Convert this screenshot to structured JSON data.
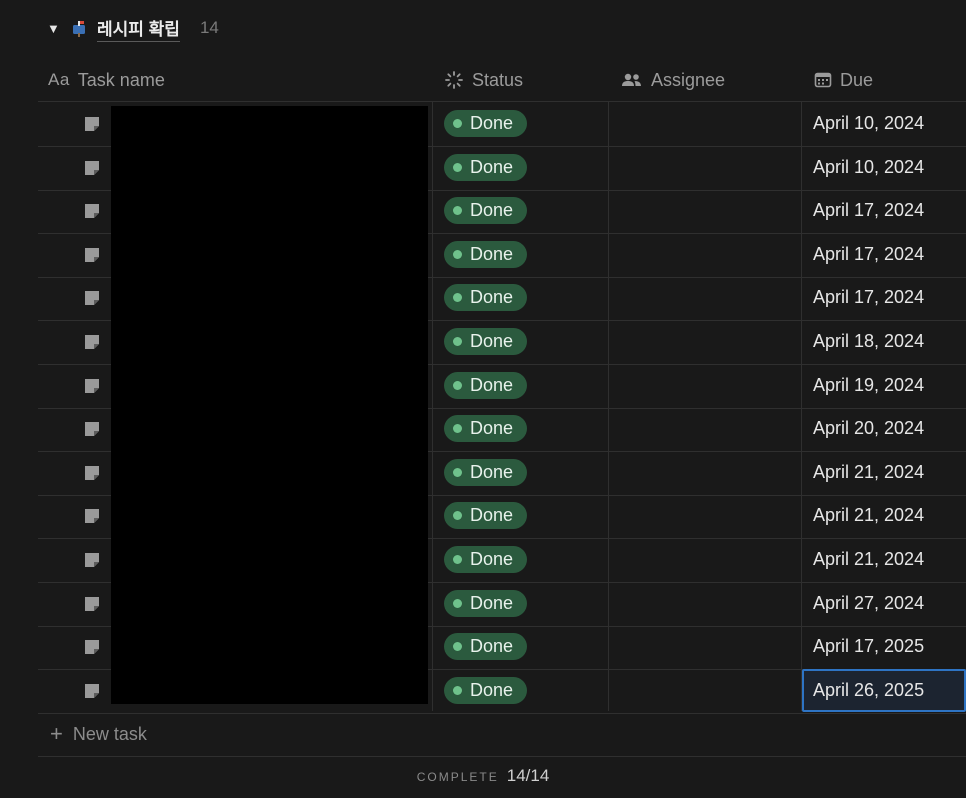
{
  "group": {
    "title": "레시피 확립",
    "count": "14",
    "icon": "mailbox-icon"
  },
  "columns": {
    "name_prefix": "Aa",
    "name": "Task name",
    "status": "Status",
    "assignee": "Assignee",
    "due": "Due"
  },
  "rows": [
    {
      "status": "Done",
      "due": "April 10, 2024"
    },
    {
      "status": "Done",
      "due": "April 10, 2024"
    },
    {
      "status": "Done",
      "due": "April 17, 2024"
    },
    {
      "status": "Done",
      "due": "April 17, 2024"
    },
    {
      "status": "Done",
      "due": "April 17, 2024"
    },
    {
      "status": "Done",
      "due": "April 18, 2024"
    },
    {
      "status": "Done",
      "due": "April 19, 2024"
    },
    {
      "status": "Done",
      "due": "April 20, 2024"
    },
    {
      "status": "Done",
      "due": "April 21, 2024"
    },
    {
      "status": "Done",
      "due": "April 21, 2024"
    },
    {
      "status": "Done",
      "due": "April 21, 2024"
    },
    {
      "status": "Done",
      "due": "April 27, 2024"
    },
    {
      "status": "Done",
      "due": "April 17, 2025"
    },
    {
      "status": "Done",
      "due": "April 26, 2025"
    }
  ],
  "selected_row": 13,
  "new_task_label": "New task",
  "footer": {
    "label": "COMPLETE",
    "value": "14/14"
  },
  "colors": {
    "background": "#191919",
    "status_done_bg": "#2b5a3e",
    "status_done_dot": "#6fc28c",
    "selection": "#2e74c4"
  }
}
